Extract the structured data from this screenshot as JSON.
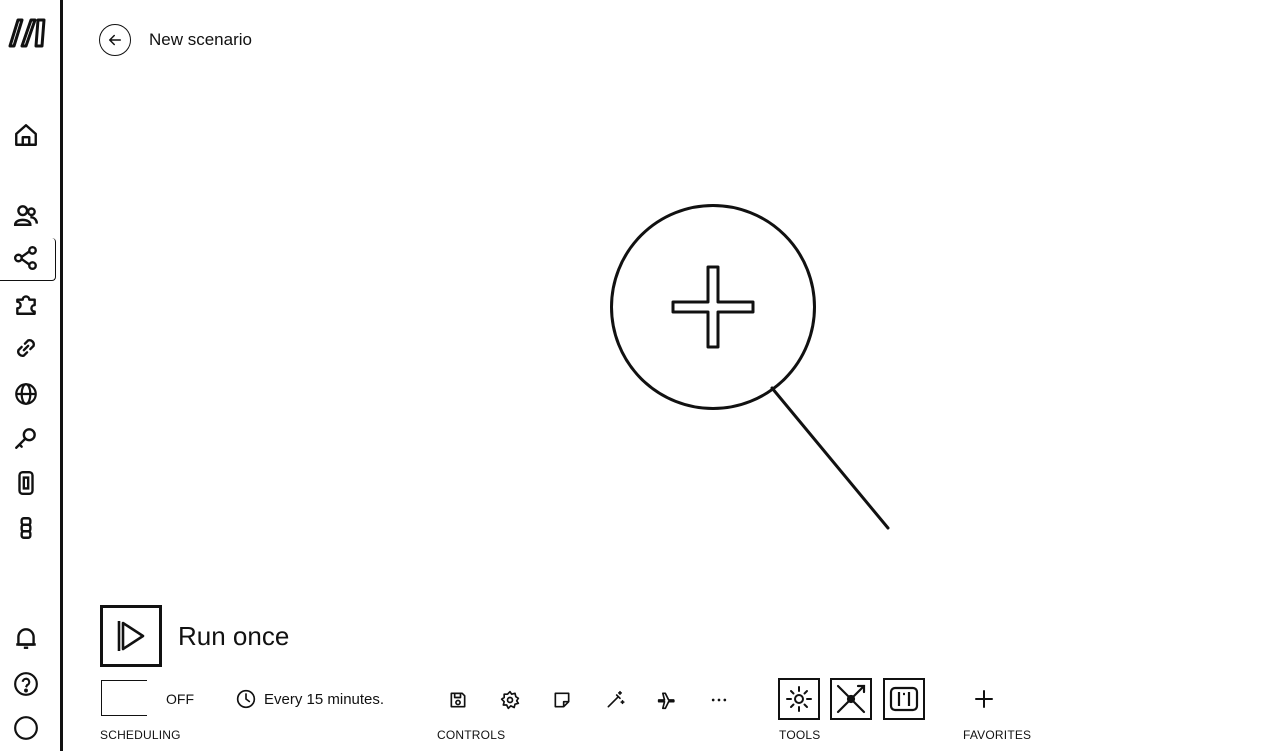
{
  "header": {
    "title": "New scenario",
    "back_icon": "arrow-left-icon"
  },
  "sidebar": {
    "logo": "make-logo",
    "items": [
      {
        "name": "home",
        "icon": "home-icon"
      },
      {
        "name": "team",
        "icon": "users-icon"
      },
      {
        "name": "scenarios",
        "icon": "share-nodes-icon",
        "active": true
      },
      {
        "name": "templates",
        "icon": "puzzle-icon"
      },
      {
        "name": "connections",
        "icon": "link-icon"
      },
      {
        "name": "webhooks",
        "icon": "globe-icon"
      },
      {
        "name": "keys",
        "icon": "key-icon"
      },
      {
        "name": "devices",
        "icon": "device-icon"
      },
      {
        "name": "data-structures",
        "icon": "data-structure-icon"
      }
    ],
    "bottom_items": [
      {
        "name": "notifications",
        "icon": "bell-icon"
      },
      {
        "name": "help",
        "icon": "help-icon"
      },
      {
        "name": "profile",
        "icon": "avatar-icon"
      }
    ]
  },
  "canvas": {
    "add_icon": "plus-icon"
  },
  "run": {
    "label": "Run once"
  },
  "toolbar": {
    "scheduling": {
      "toggle_label": "OFF",
      "schedule_text": "Every 15 minutes.",
      "section_label": "SCHEDULING"
    },
    "controls": {
      "section_label": "CONTROLS",
      "items": [
        "save-icon",
        "settings-icon",
        "notes-icon",
        "magic-wand-icon",
        "airplane-icon",
        "more-icon"
      ]
    },
    "tools": {
      "section_label": "TOOLS",
      "items": [
        "tools-gear-icon",
        "flow-control-icon",
        "text-parser-icon"
      ]
    },
    "favorites": {
      "section_label": "FAVORITES",
      "add_icon": "plus-icon"
    }
  }
}
